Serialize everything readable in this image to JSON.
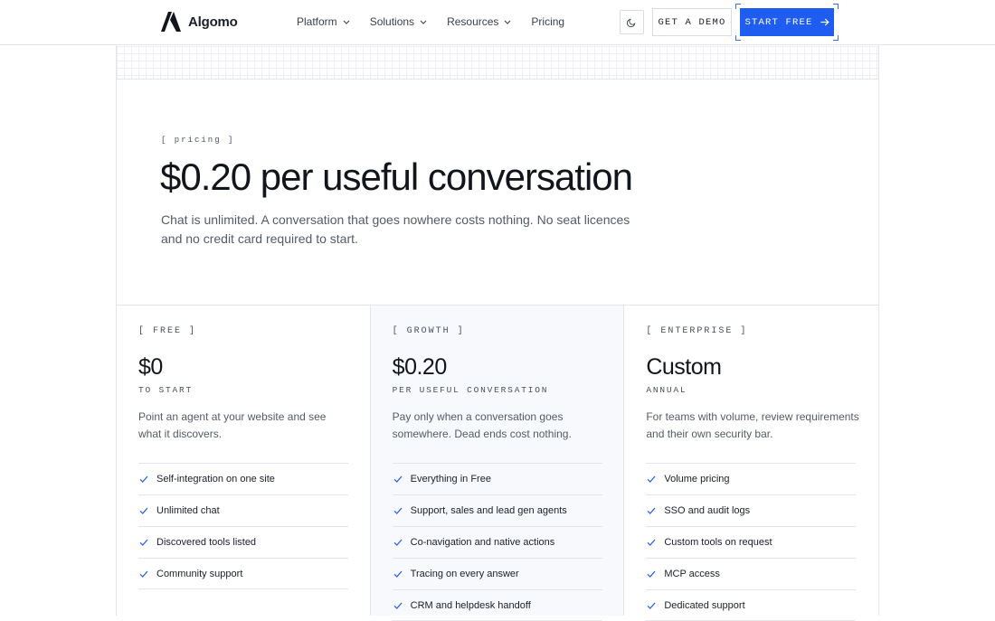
{
  "header": {
    "brand": "Algomo",
    "nav": [
      {
        "label": "Platform",
        "has_menu": true
      },
      {
        "label": "Solutions",
        "has_menu": true
      },
      {
        "label": "Resources",
        "has_menu": true
      },
      {
        "label": "Pricing",
        "has_menu": false
      }
    ],
    "theme_icon": "moon-icon",
    "demo_label": "GET A DEMO",
    "start_label": "START FREE",
    "accent": "#1f5cf0"
  },
  "hero": {
    "eyebrow": "[ pricing ]",
    "title": "$0.20 per useful conversation",
    "subtitle": "Chat is unlimited. A conversation that goes nowhere costs nothing. No seat licences and no credit card required to start."
  },
  "plans": [
    {
      "tier": "[ FREE ]",
      "price": "$0",
      "unit": "TO START",
      "description": "Point an agent at your website and see what it discovers.",
      "features": [
        "Self-integration on one site",
        "Unlimited chat",
        "Discovered tools listed",
        "Community support"
      ]
    },
    {
      "tier": "[ GROWTH ]",
      "price": "$0.20",
      "unit": "PER USEFUL CONVERSATION",
      "description": "Pay only when a conversation goes somewhere. Dead ends cost nothing.",
      "features": [
        "Everything in Free",
        "Support, sales and lead gen agents",
        "Co-navigation and native actions",
        "Tracing on every answer",
        "CRM and helpdesk handoff"
      ]
    },
    {
      "tier": "[ ENTERPRISE ]",
      "price": "Custom",
      "unit": "ANNUAL",
      "description": "For teams with volume, review requirements and their own security bar.",
      "features": [
        "Volume pricing",
        "SSO and audit logs",
        "Custom tools on request",
        "MCP access",
        "Dedicated support"
      ]
    }
  ],
  "icons": {
    "check": "check-icon",
    "chevron": "chevron-down-icon",
    "arrow": "arrow-right-icon"
  }
}
